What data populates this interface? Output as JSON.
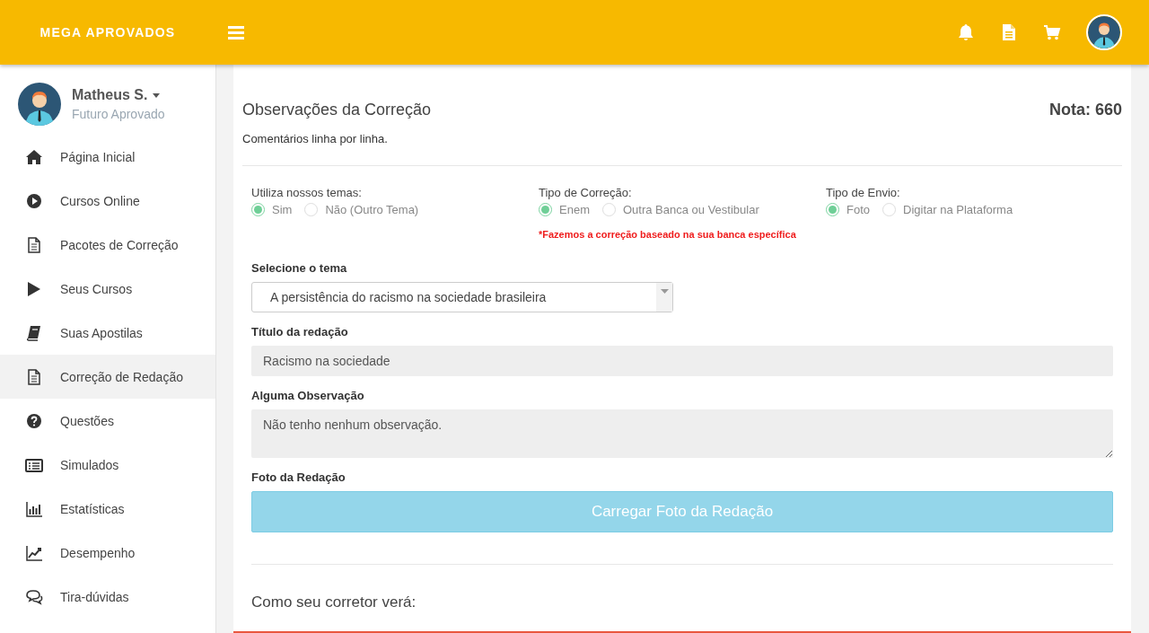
{
  "topbar": {
    "brand": "MEGA APROVADOS"
  },
  "user": {
    "name": "Matheus S.",
    "subtitle": "Futuro Aprovado"
  },
  "sidebar": {
    "items": [
      {
        "label": "Página Inicial",
        "selected": false
      },
      {
        "label": "Cursos Online",
        "selected": false
      },
      {
        "label": "Pacotes de Correção",
        "selected": false
      },
      {
        "label": "Seus Cursos",
        "selected": false
      },
      {
        "label": "Suas Apostilas",
        "selected": false
      },
      {
        "label": "Correção de Redação",
        "selected": true
      },
      {
        "label": "Questões",
        "selected": false
      },
      {
        "label": "Simulados",
        "selected": false
      },
      {
        "label": "Estatísticas",
        "selected": false
      },
      {
        "label": "Desempenho",
        "selected": false
      },
      {
        "label": "Tira-dúvidas",
        "selected": false
      }
    ]
  },
  "card": {
    "title": "Observações da Correção",
    "grade": "Nota: 660",
    "subtitle": "Comentários linha por linha.",
    "radio_groups": [
      {
        "label": "Utiliza nossos temas:",
        "options": [
          {
            "label": "Sim",
            "selected": true
          },
          {
            "label": "Não (Outro Tema)",
            "selected": false
          }
        ]
      },
      {
        "label": "Tipo de Correção:",
        "options": [
          {
            "label": "Enem",
            "selected": true
          },
          {
            "label": "Outra Banca ou Vestibular",
            "selected": false
          }
        ],
        "note": "*Fazemos a correção baseado na sua banca específica"
      },
      {
        "label": "Tipo de Envio:",
        "options": [
          {
            "label": "Foto",
            "selected": true
          },
          {
            "label": "Digitar na Plataforma",
            "selected": false
          }
        ]
      }
    ],
    "theme": {
      "label": "Selecione o tema",
      "value": "A persistência do racismo na sociedade brasileira"
    },
    "essay_title": {
      "label": "Título da redação",
      "value": "Racismo na sociedade"
    },
    "observation": {
      "label": "Alguma Observação",
      "value": "Não tenho nenhum observação."
    },
    "photo": {
      "label": "Foto da Redação",
      "button": "Carregar Foto da Redação"
    },
    "preview_heading": "Como seu corretor verá:"
  }
}
